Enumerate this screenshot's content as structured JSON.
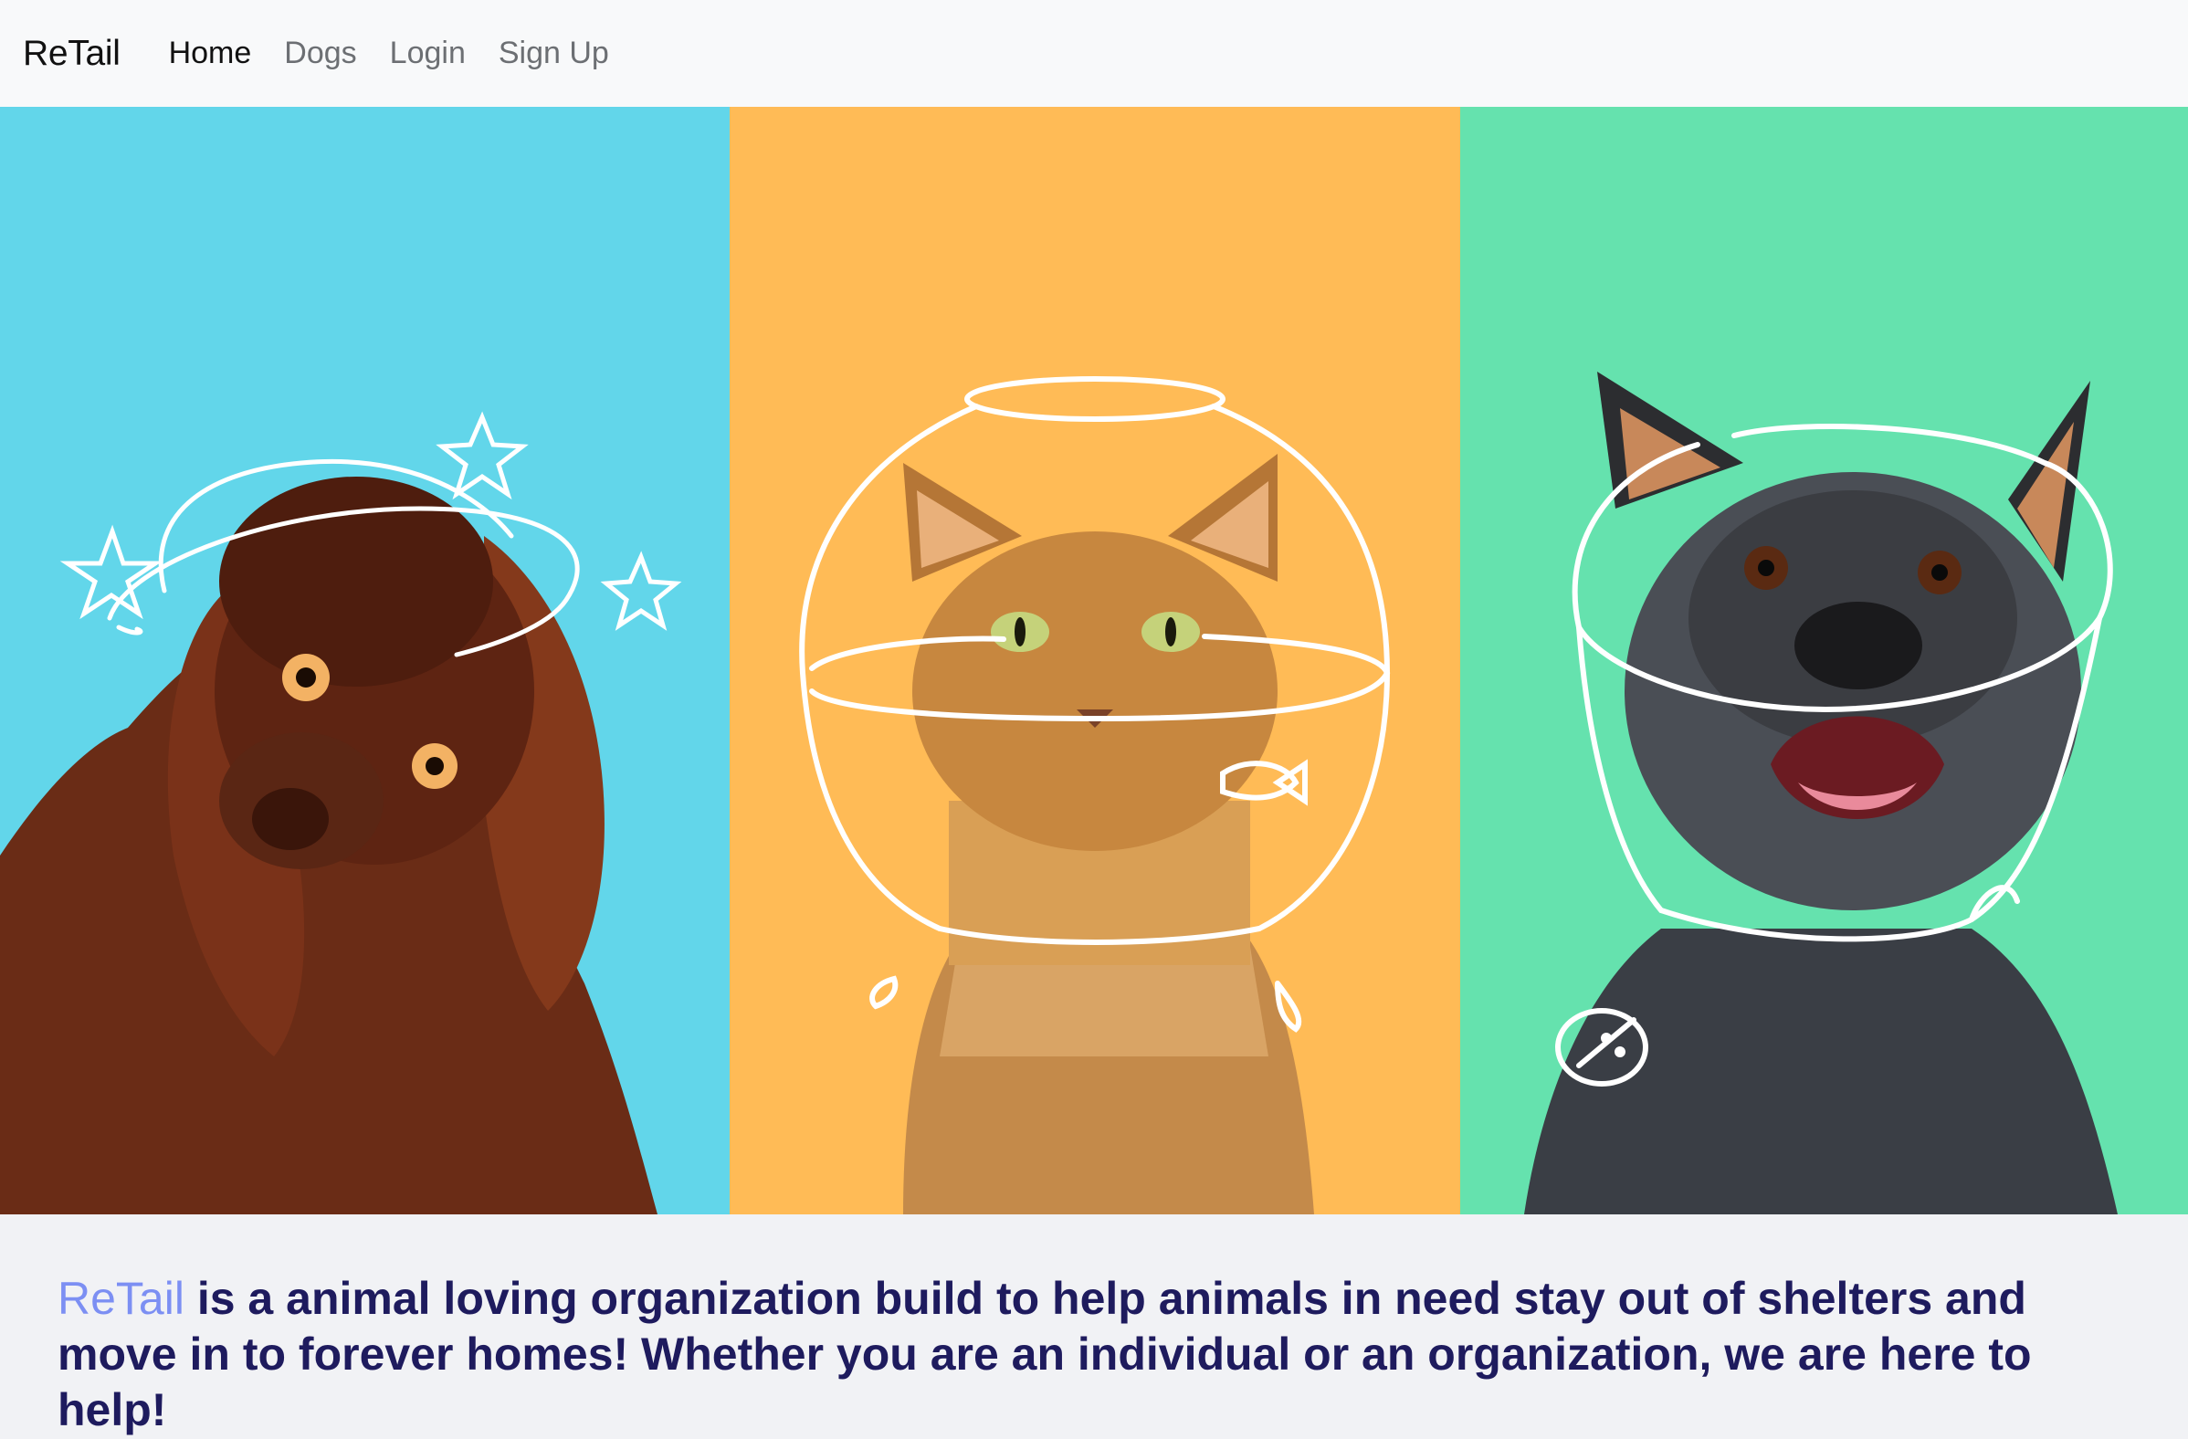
{
  "navbar": {
    "brand": "ReTail",
    "links": [
      {
        "label": "Home",
        "active": true
      },
      {
        "label": "Dogs",
        "active": false
      },
      {
        "label": "Login",
        "active": false
      },
      {
        "label": "Sign Up",
        "active": false
      }
    ]
  },
  "hero": {
    "panels": [
      {
        "name": "dizzy-spaniel-photo",
        "background": "#62d6ea"
      },
      {
        "name": "fishbowl-cat-photo",
        "background": "#ffbb56"
      },
      {
        "name": "cone-heeler-photo",
        "background": "#65e2ae"
      }
    ]
  },
  "intro": {
    "brand_word": "ReTail",
    "text": " is a animal loving organization build to help animals in need stay out of shelters and move in to forever homes! Whether you are an individual or an organization, we are here to help!"
  },
  "colors": {
    "text_dark": "#1e1b5e",
    "brand_accent": "#7c8ff3",
    "navbar_bg": "#f8f9fa",
    "page_bg": "#f1f2f5"
  }
}
